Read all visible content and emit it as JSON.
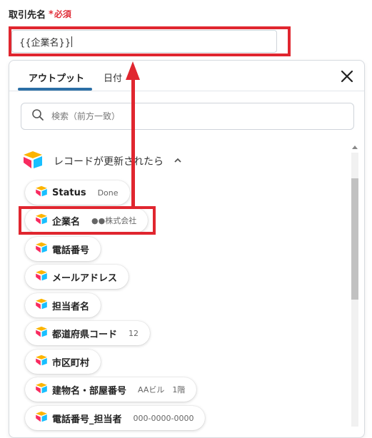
{
  "field": {
    "label": "取引先名",
    "required_star": "*",
    "required_text": "必須",
    "value": "{{企業名}}"
  },
  "panel": {
    "tabs": [
      {
        "label": "アウトプット",
        "active": true
      },
      {
        "label": "日付",
        "active": false
      }
    ],
    "search": {
      "placeholder": "検索（前方一致）"
    },
    "section": {
      "label": "レコードが更新されたら"
    },
    "items": [
      {
        "label": "Status",
        "value": "Done"
      },
      {
        "label": "企業名",
        "value": "●●株式会社"
      },
      {
        "label": "電話番号",
        "value": ""
      },
      {
        "label": "メールアドレス",
        "value": ""
      },
      {
        "label": "担当者名",
        "value": ""
      },
      {
        "label": "都道府県コード",
        "value": "12"
      },
      {
        "label": "市区町村",
        "value": ""
      },
      {
        "label": "建物名・部屋番号",
        "value": "AAビル　1階"
      },
      {
        "label": "電話番号_担当者",
        "value": "000-0000-0000"
      }
    ]
  },
  "colors": {
    "highlight": "#e0262f",
    "tab_underline": "#2c6fa6",
    "required": "#e0303a"
  },
  "icons": [
    "airtable-logo-icon",
    "search-icon",
    "close-icon",
    "chevron-up-icon"
  ]
}
